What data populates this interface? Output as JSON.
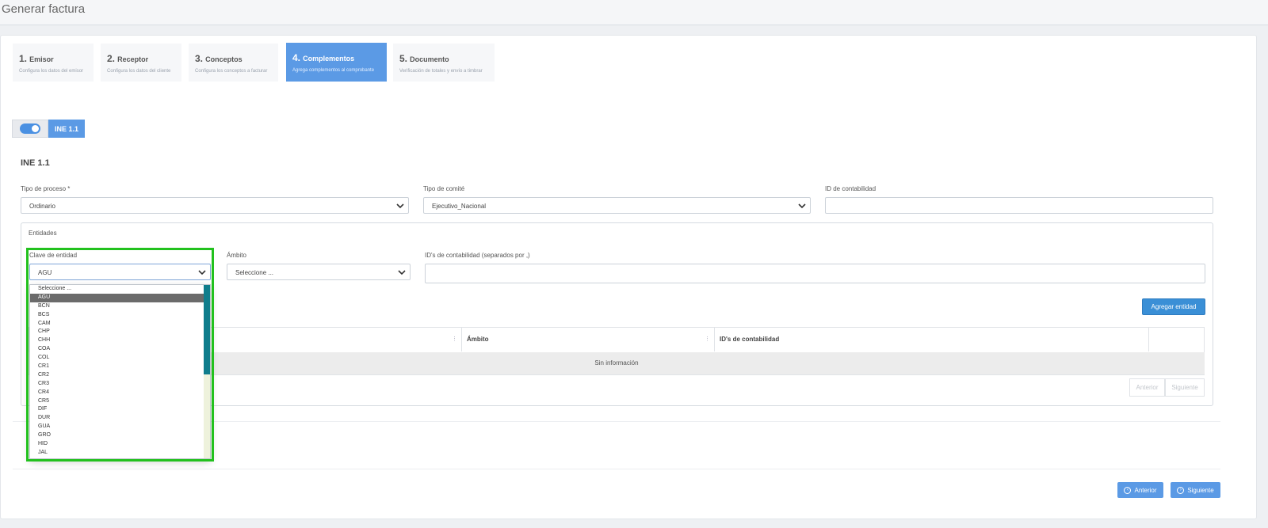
{
  "header": {
    "title": "Generar factura"
  },
  "steps": [
    {
      "number": "1.",
      "title": "Emisor",
      "subtitle": "Configura los datos del emisor"
    },
    {
      "number": "2.",
      "title": "Receptor",
      "subtitle": "Configura los datos del cliente"
    },
    {
      "number": "3.",
      "title": "Conceptos",
      "subtitle": "Configura los conceptos a facturar"
    },
    {
      "number": "4.",
      "title": "Complementos",
      "subtitle": "Agrega complementos al comprobante"
    },
    {
      "number": "5.",
      "title": "Documento",
      "subtitle": "Verificación de totales y envío a timbrar"
    }
  ],
  "toggle": {
    "label": "INE 1.1",
    "checked": true
  },
  "section": {
    "title": "INE 1.1"
  },
  "form": {
    "tipo_proceso": {
      "label": "Tipo de proceso *",
      "value": "Ordinario"
    },
    "tipo_comite": {
      "label": "Tipo de comité",
      "value": "Ejecutivo_Nacional"
    },
    "id_contabilidad": {
      "label": "ID de contabilidad",
      "value": ""
    }
  },
  "entidades": {
    "legend": "Entidades",
    "clave": {
      "label": "Clave de entidad",
      "value": "AGU"
    },
    "ambito": {
      "label": "Ámbito",
      "value": "Seleccione ..."
    },
    "ids": {
      "label": "ID's de contabilidad (separados por ,)",
      "value": ""
    },
    "add_button": "Agregar entidad",
    "table": {
      "columns": [
        "Ámbito",
        "ID's de contabilidad"
      ],
      "empty": "Sin información"
    },
    "pager": {
      "prev": "Anterior",
      "next": "Siguiente"
    }
  },
  "dropdown": {
    "selected": "AGU",
    "options": [
      "Seleccione ...",
      "AGU",
      "BCN",
      "BCS",
      "CAM",
      "CHP",
      "CHH",
      "COA",
      "COL",
      "CR1",
      "CR2",
      "CR3",
      "CR4",
      "CR5",
      "DIF",
      "DUR",
      "GUA",
      "GRO",
      "HID",
      "JAL"
    ]
  },
  "footer": {
    "prev": "Anterior",
    "next": "Siguiente"
  },
  "colors": {
    "primary": "#5b9ae5",
    "button": "#3a8fd6",
    "highlight": "#22c11e",
    "scroll": "#0f7d8c"
  }
}
